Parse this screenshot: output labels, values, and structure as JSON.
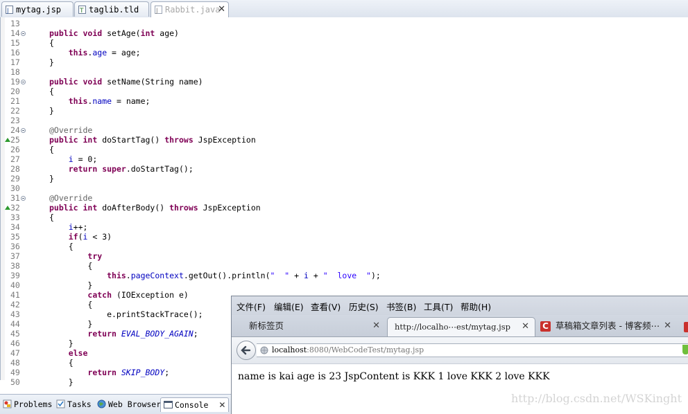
{
  "editor_tabs": [
    {
      "label": "mytag.jsp"
    },
    {
      "label": "taglib.tld"
    },
    {
      "label": "Rabbit.java",
      "close": "✕"
    }
  ],
  "code_lines": [
    {
      "num": "13",
      "html": ""
    },
    {
      "num": "14",
      "html": "<span class=\"kw\">public</span> <span class=\"kw\">void</span> setAge(<span class=\"kw\">int</span> age)"
    },
    {
      "num": "15",
      "html": "{"
    },
    {
      "num": "16",
      "html": "    <span class=\"kw\">this</span>.<span class=\"fd\">age</span> = age;"
    },
    {
      "num": "17",
      "html": "}"
    },
    {
      "num": "18",
      "html": ""
    },
    {
      "num": "19",
      "html": "<span class=\"kw\">public</span> <span class=\"kw\">void</span> setName(String name)"
    },
    {
      "num": "20",
      "html": "{"
    },
    {
      "num": "21",
      "html": "    <span class=\"kw\">this</span>.<span class=\"fd\">name</span> = name;"
    },
    {
      "num": "22",
      "html": "}"
    },
    {
      "num": "23",
      "html": ""
    },
    {
      "num": "24",
      "html": "<span class=\"an\">@Override</span>"
    },
    {
      "num": "25",
      "html": "<span class=\"kw\">public</span> <span class=\"kw\">int</span> doStartTag() <span class=\"kw\">throws</span> JspException"
    },
    {
      "num": "26",
      "html": "{"
    },
    {
      "num": "27",
      "html": "    <span class=\"fd\">i</span> = 0;"
    },
    {
      "num": "28",
      "html": "    <span class=\"kw\">return</span> <span class=\"kw\">super</span>.doStartTag();"
    },
    {
      "num": "29",
      "html": "}"
    },
    {
      "num": "30",
      "html": ""
    },
    {
      "num": "31",
      "html": "<span class=\"an\">@Override</span>"
    },
    {
      "num": "32",
      "html": "<span class=\"kw\">public</span> <span class=\"kw\">int</span> doAfterBody() <span class=\"kw\">throws</span> JspException"
    },
    {
      "num": "33",
      "html": "{"
    },
    {
      "num": "34",
      "html": "    <span class=\"fd\">i</span>++;"
    },
    {
      "num": "35",
      "html": "    <span class=\"kw\">if</span>(<span class=\"fd\">i</span> &lt; 3)"
    },
    {
      "num": "36",
      "html": "    {"
    },
    {
      "num": "37",
      "html": "        <span class=\"kw\">try</span>"
    },
    {
      "num": "38",
      "html": "        {"
    },
    {
      "num": "39",
      "html": "            <span class=\"kw\">this</span>.<span class=\"fd\">pageContext</span>.getOut().println(<span class=\"st\">\"  \"</span> + <span class=\"fd\">i</span> + <span class=\"st\">\"  love  \"</span>);"
    },
    {
      "num": "40",
      "html": "        }"
    },
    {
      "num": "41",
      "html": "        <span class=\"kw\">catch</span> (IOException e)"
    },
    {
      "num": "42",
      "html": "        {"
    },
    {
      "num": "43",
      "html": "            e.printStackTrace();"
    },
    {
      "num": "44",
      "html": "        }"
    },
    {
      "num": "45",
      "html": "        <span class=\"kw\">return</span> <span class=\"it\">EVAL_BODY_AGAIN</span>;"
    },
    {
      "num": "46",
      "html": "    }"
    },
    {
      "num": "47",
      "html": "    <span class=\"kw\">else</span>"
    },
    {
      "num": "48",
      "html": "    {"
    },
    {
      "num": "49",
      "html": "        <span class=\"kw\">return</span> <span class=\"it\">SKIP_BODY</span>;"
    },
    {
      "num": "50",
      "html": "    }"
    }
  ],
  "fold_lines": [
    "14",
    "19",
    "24",
    "31"
  ],
  "override_lines": [
    "25",
    "32"
  ],
  "views": [
    {
      "label": "Problems"
    },
    {
      "label": "Tasks"
    },
    {
      "label": "Web Browser"
    },
    {
      "label": "Console",
      "close": "✕"
    }
  ],
  "browser": {
    "menu": [
      "文件(F)",
      "编辑(E)",
      "查看(V)",
      "历史(S)",
      "书签(B)",
      "工具(T)",
      "帮助(H)"
    ],
    "tabs": [
      {
        "label": "新标签页",
        "close": "✕"
      },
      {
        "label": "http://localho⋯est/mytag.jsp",
        "close": "✕"
      },
      {
        "label": "草稿箱文章列表 - 博客频⋯",
        "close": "✕"
      }
    ],
    "url_host": "localhost",
    "url_rest": ":8080/WebCodeTest/mytag.jsp",
    "page_text": "name is kai age is 23 JspContent is KKK 1 love KKK 2 love KKK",
    "watermark": "http://blog.csdn.net/WSKinght",
    "colors": {
      "csdn_red": "#c9302c"
    }
  }
}
